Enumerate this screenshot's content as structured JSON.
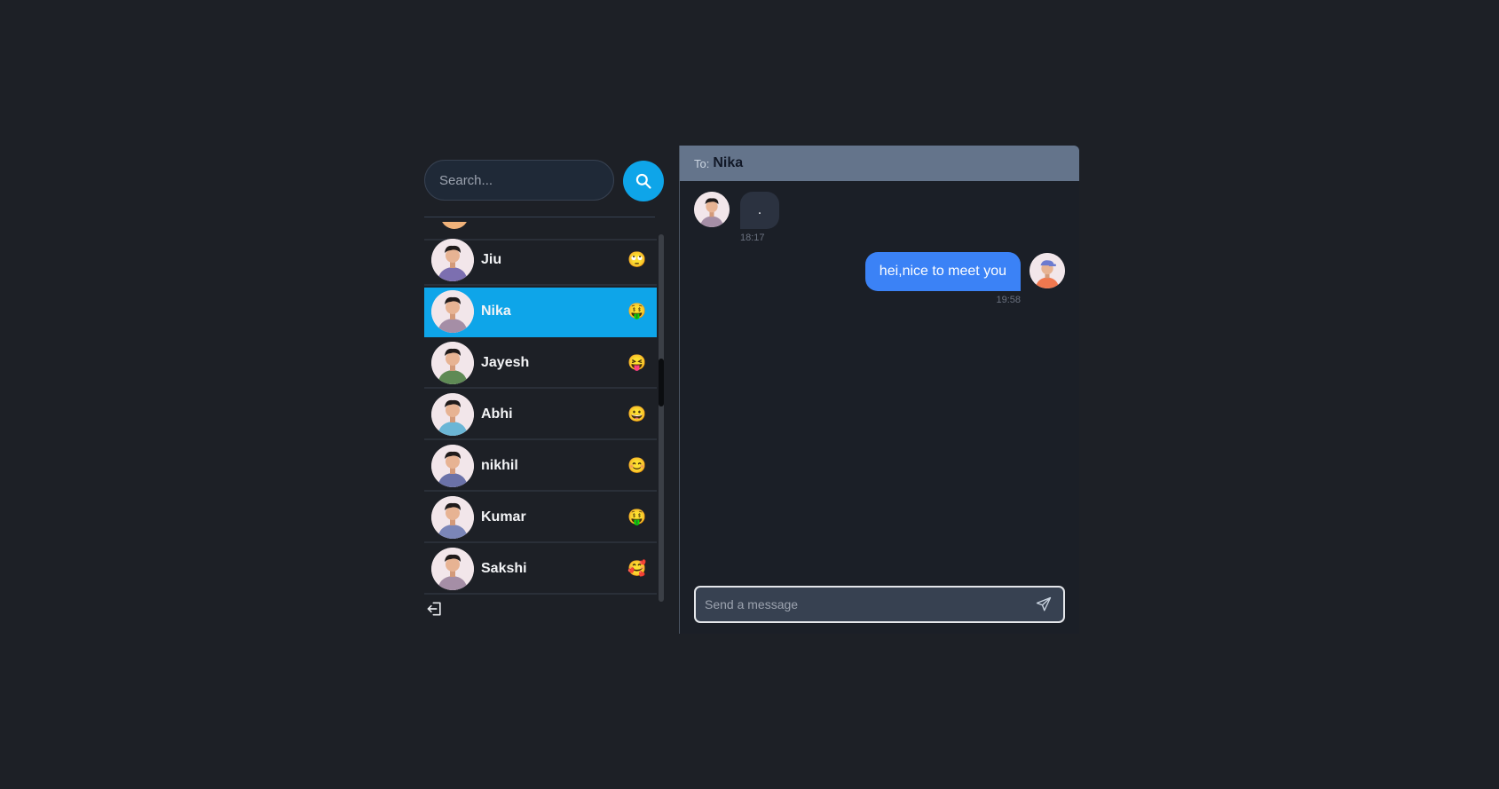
{
  "search": {
    "placeholder": "Search..."
  },
  "contacts": [
    {
      "name": "Jiu",
      "emoji": "🙄",
      "avatar_color": "#7c6fb0",
      "active": false
    },
    {
      "name": "Nika",
      "emoji": "🤑",
      "avatar_color": "#a58ea6",
      "active": true
    },
    {
      "name": "Jayesh",
      "emoji": "😝",
      "avatar_color": "#5f8a55",
      "active": false
    },
    {
      "name": "Abhi",
      "emoji": "😀",
      "avatar_color": "#6bb6d6",
      "active": false
    },
    {
      "name": "nikhil",
      "emoji": "😊",
      "avatar_color": "#6b72a8",
      "active": false
    },
    {
      "name": "Kumar",
      "emoji": "🤑",
      "avatar_color": "#7b86b8",
      "active": false
    },
    {
      "name": "Sakshi",
      "emoji": "🥰",
      "avatar_color": "#a58ea6",
      "active": false
    }
  ],
  "chat": {
    "to_label": "To:",
    "recipient": "Nika",
    "messages": [
      {
        "direction": "in",
        "text": ".",
        "time": "18:17"
      },
      {
        "direction": "out",
        "text": "hei,nice to meet you",
        "time": "19:58"
      }
    ],
    "composer_placeholder": "Send a message"
  },
  "colors": {
    "accent": "#0ea5e9",
    "outgoing_bubble": "#3b82f6",
    "header": "#64748b"
  },
  "icons": {
    "search": "search-icon",
    "logout": "logout-icon",
    "send": "send-icon"
  }
}
